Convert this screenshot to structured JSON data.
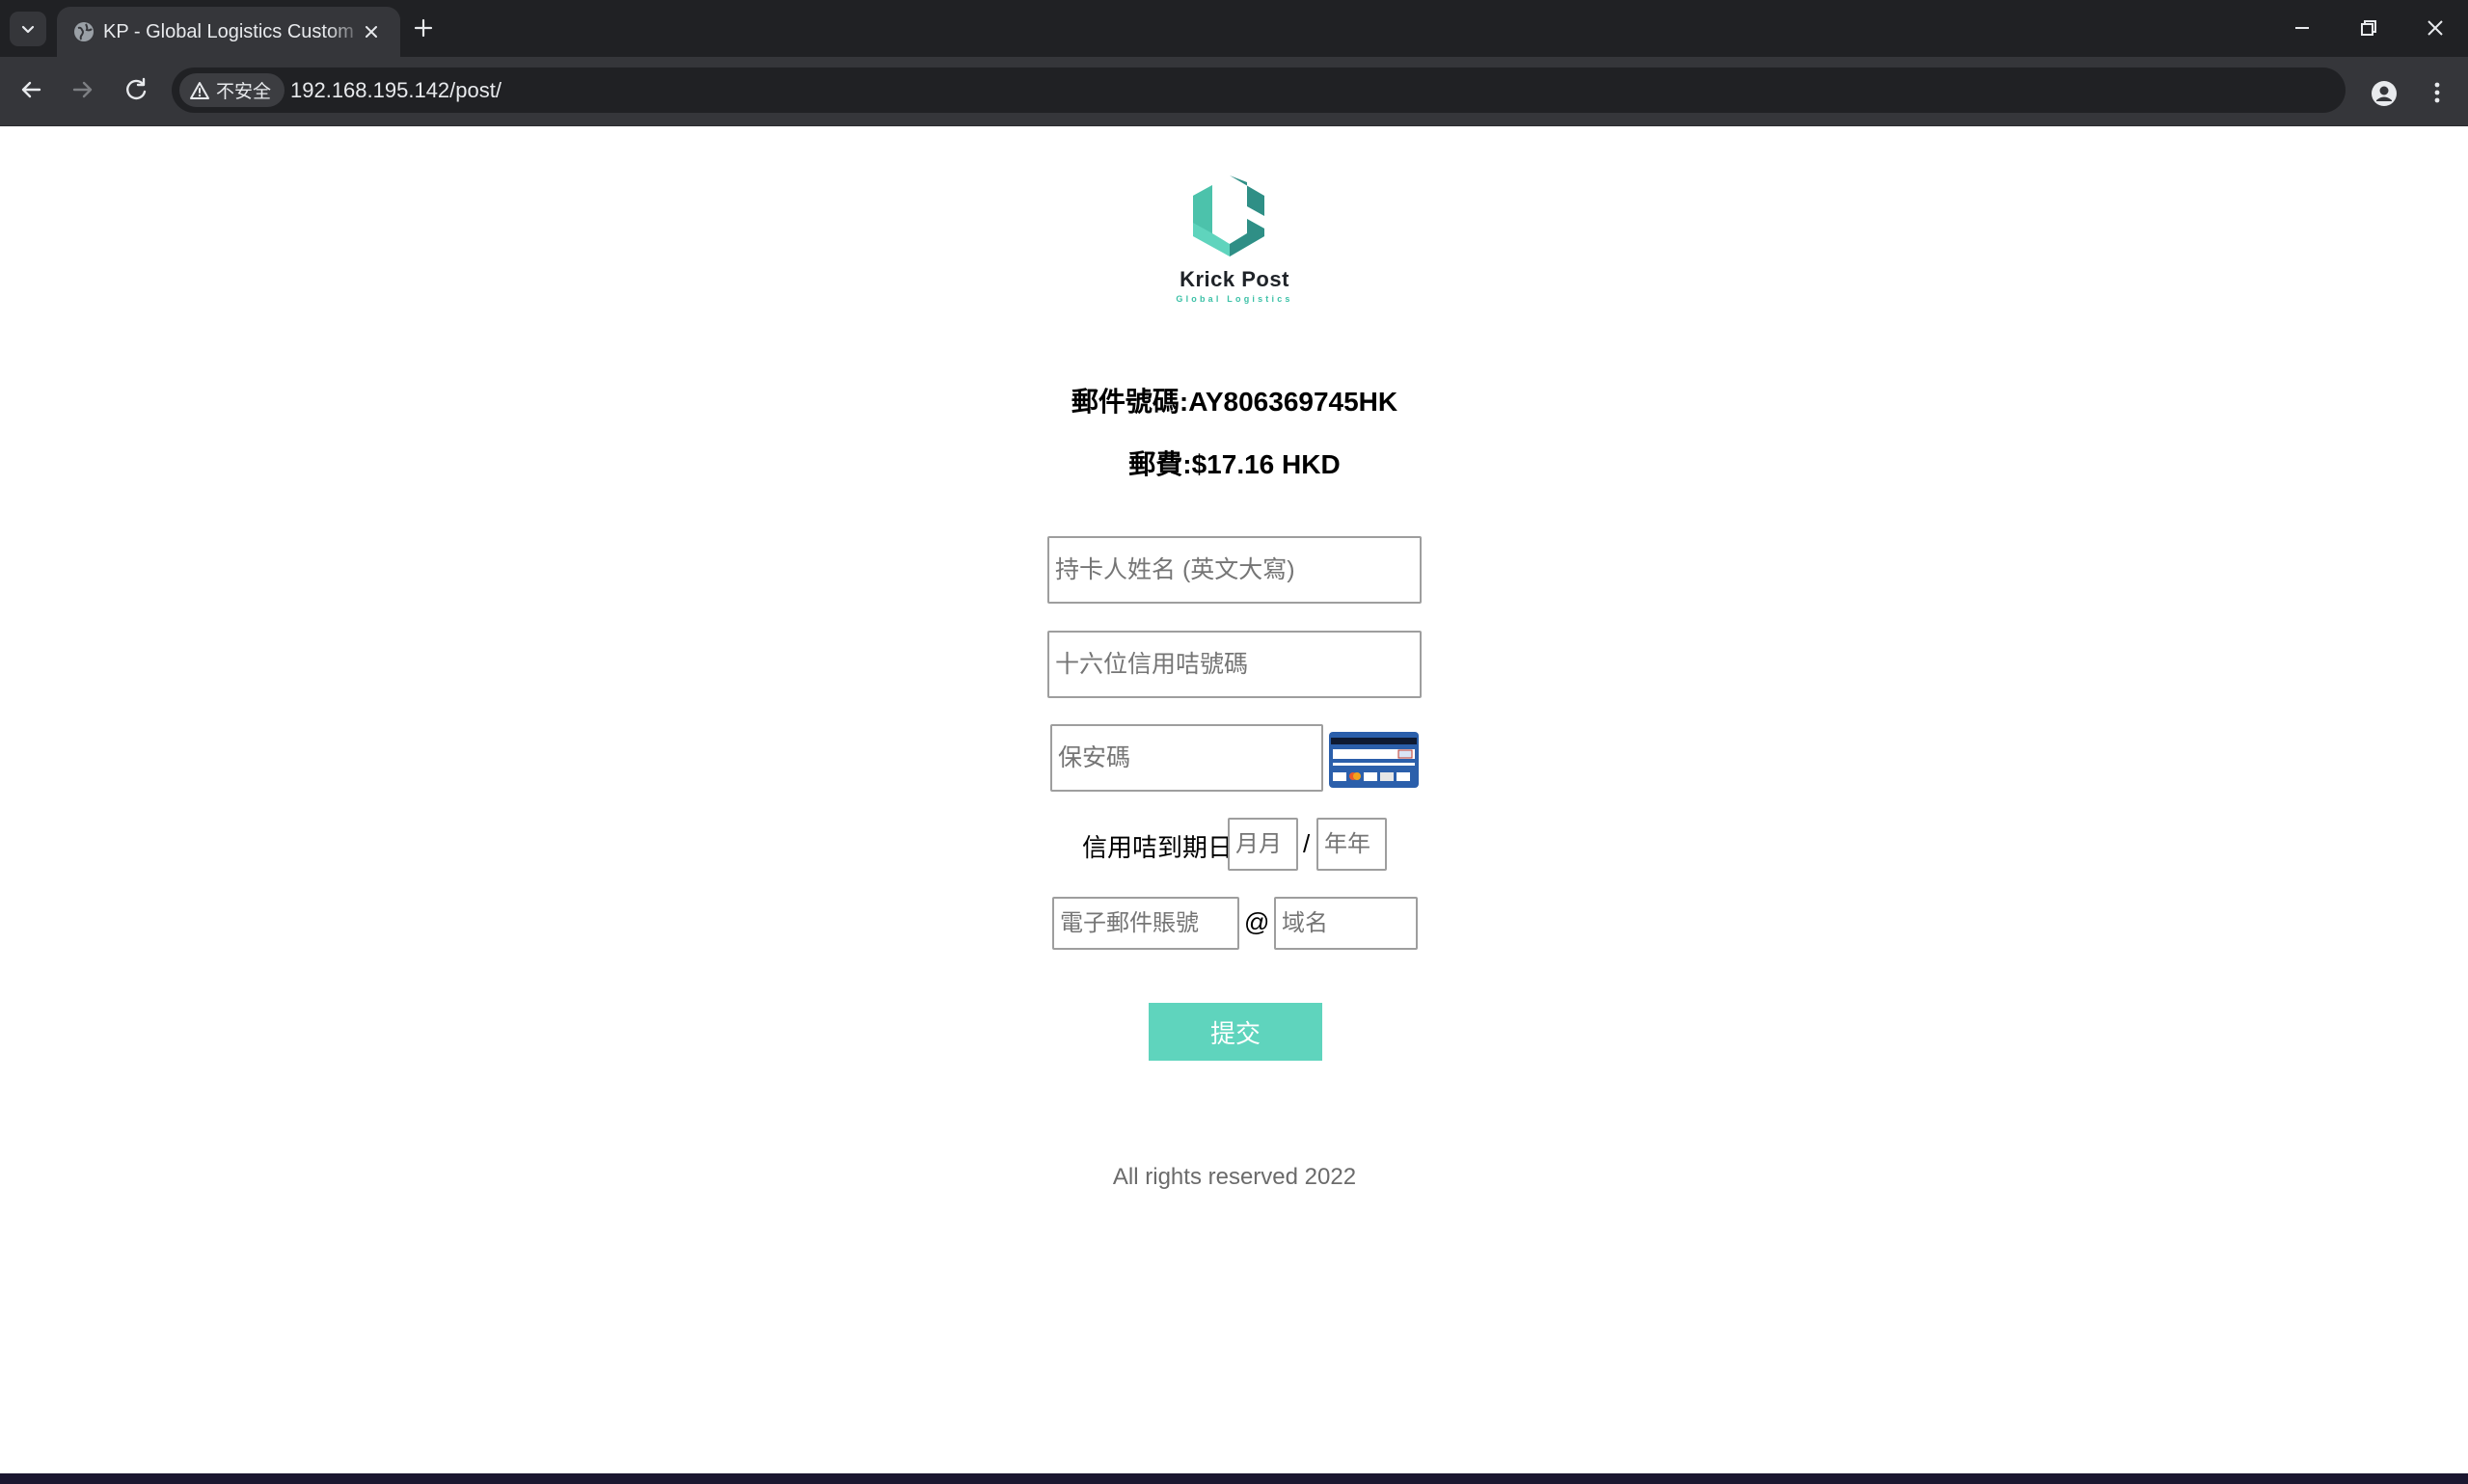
{
  "browser": {
    "tab_title": "KP - Global Logistics Customer",
    "url": "192.168.195.142/post/",
    "security_label": "不安全"
  },
  "brand": {
    "name": "Krick Post",
    "tagline": "Global Logistics",
    "colors": {
      "teal_light": "#5fd4bd",
      "teal_dark": "#2f8f86"
    }
  },
  "shipment": {
    "tracking_line": "郵件號碼:AY806369745HK",
    "fee_line": "郵費:$17.16 HKD"
  },
  "form": {
    "cardholder_placeholder": "持卡人姓名 (英文大寫)",
    "card_number_placeholder": "十六位信用咭號碼",
    "cvv_placeholder": "保安碼",
    "expiry_label": "信用咭到期日",
    "expiry_month_placeholder": "月月",
    "expiry_separator": "/",
    "expiry_year_placeholder": "年年",
    "email_account_placeholder": "電子郵件賬號",
    "email_at": "@",
    "email_domain_placeholder": "域名",
    "submit_label": "提交"
  },
  "footer": {
    "text": "All rights reserved 2022"
  }
}
